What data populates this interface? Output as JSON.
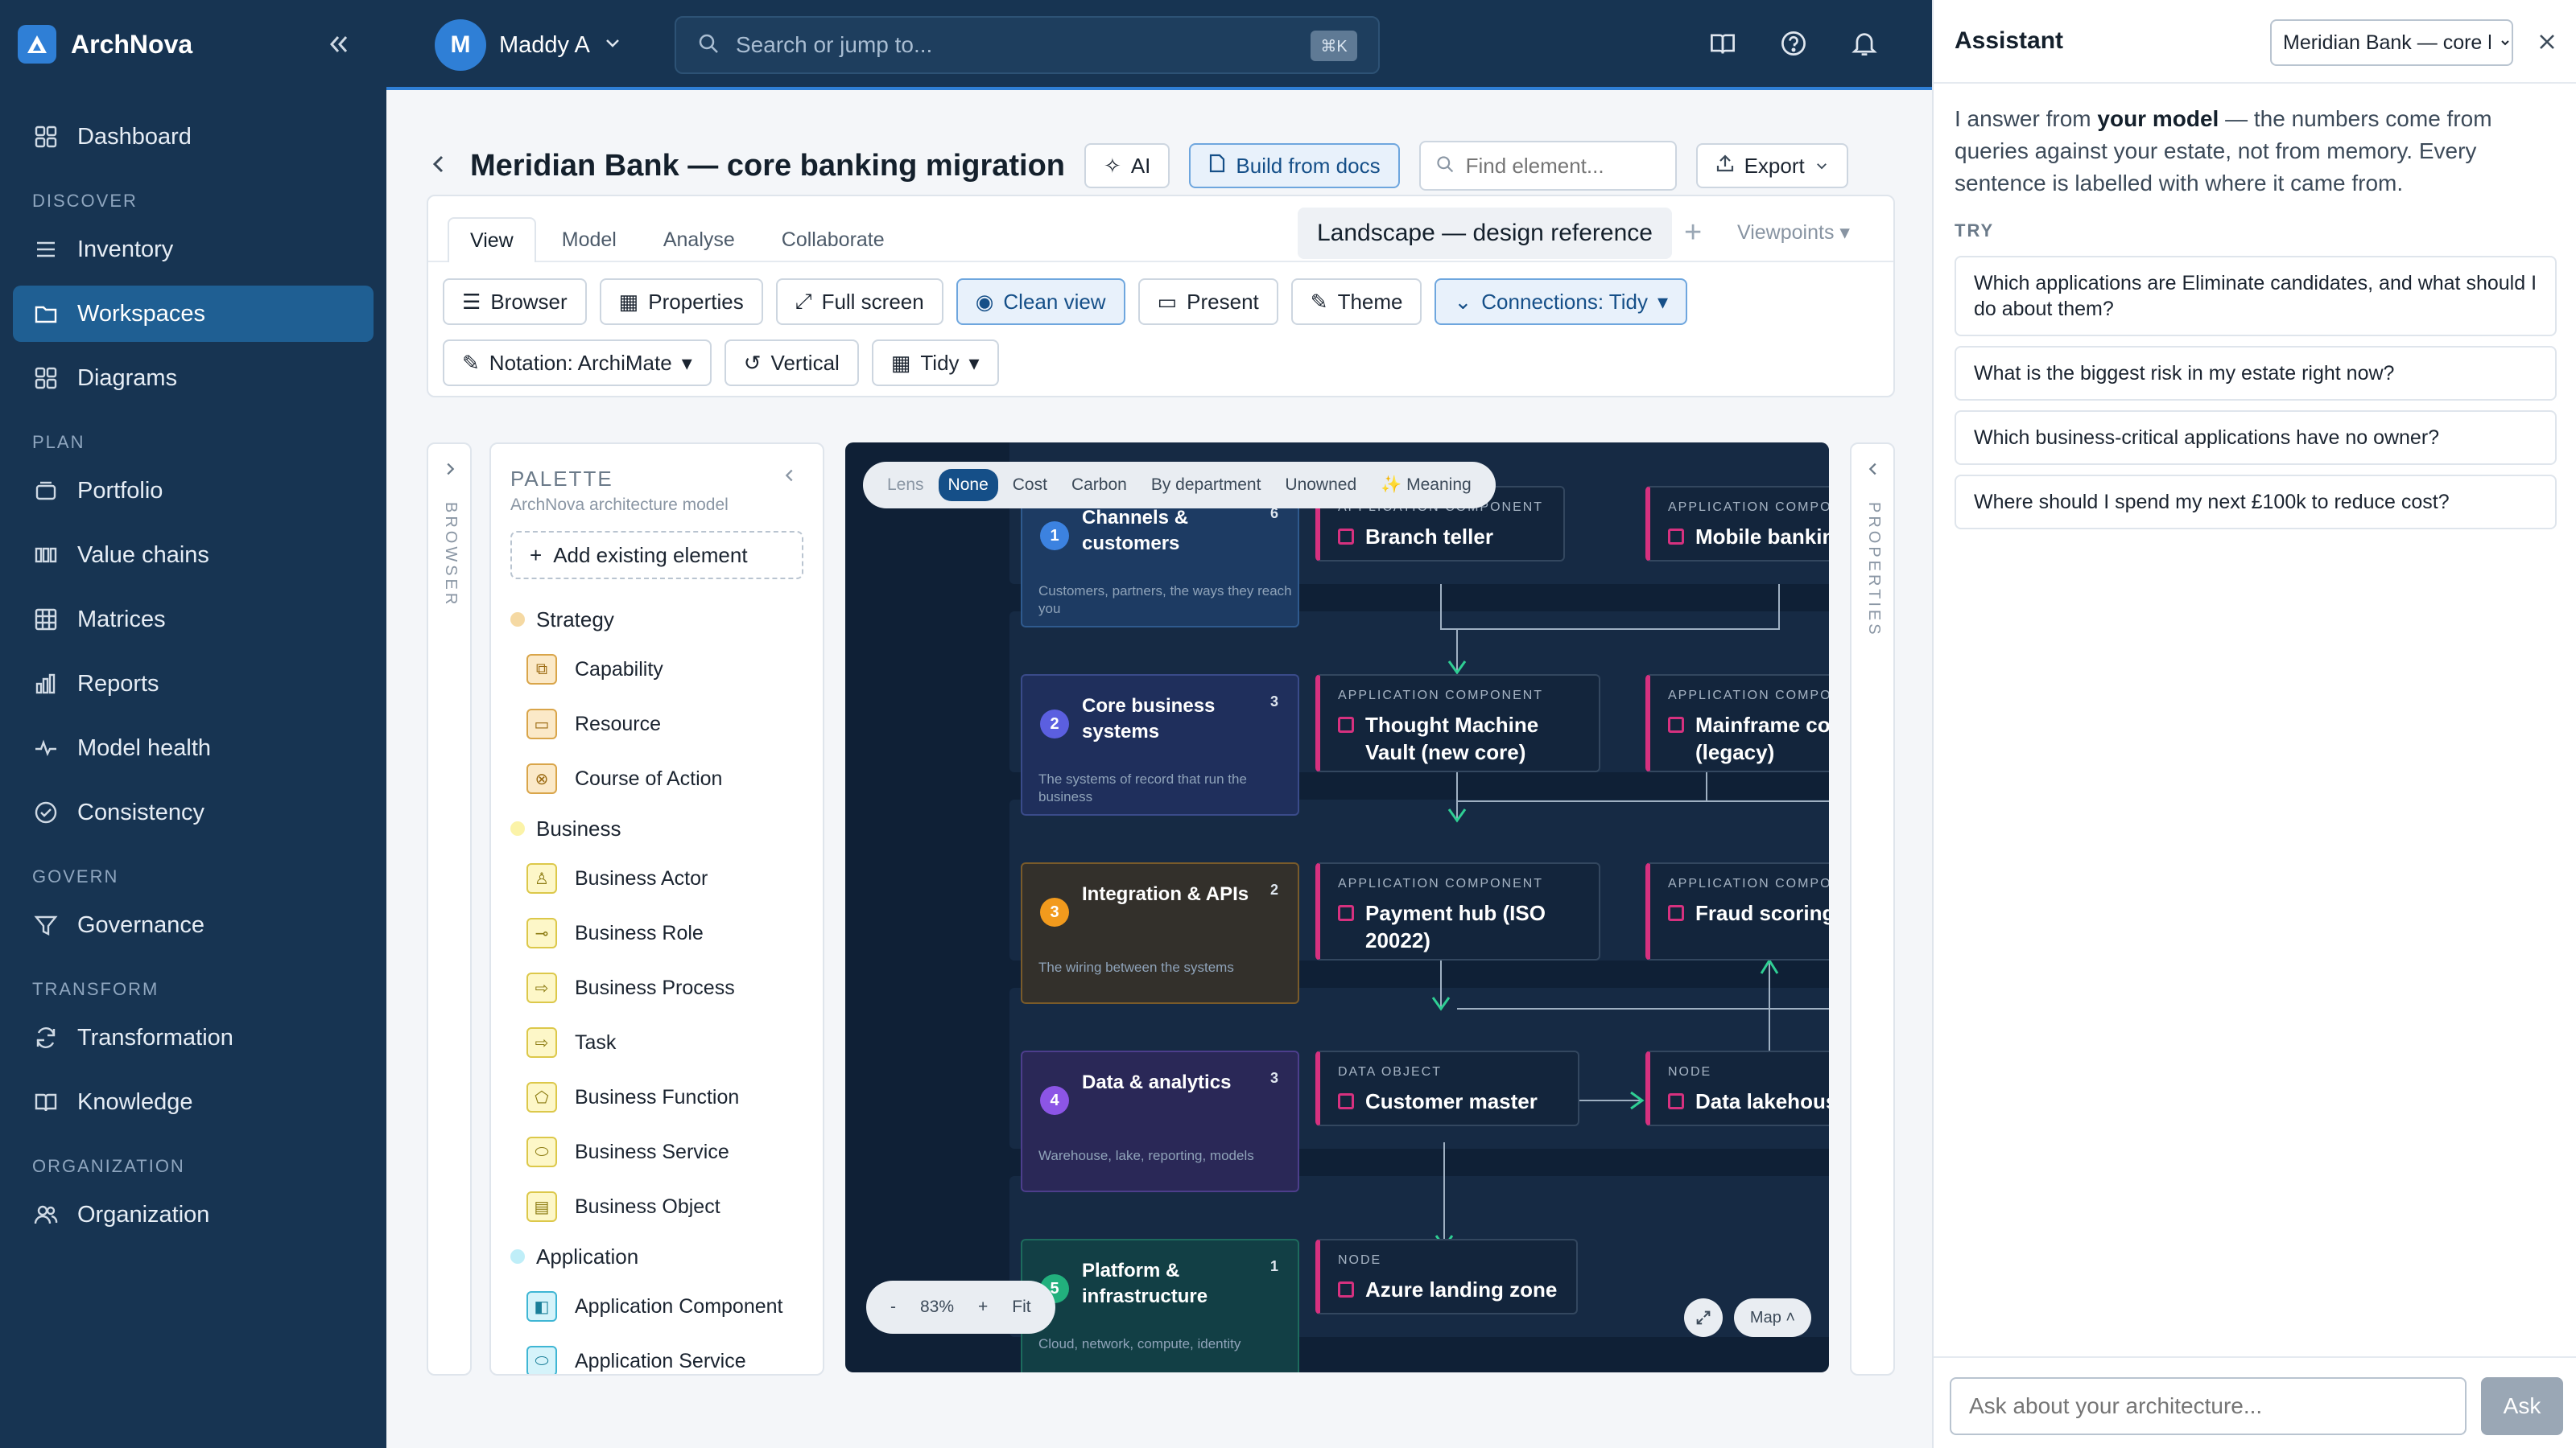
{
  "app": {
    "name": "ArchNova"
  },
  "sidebar": {
    "items": [
      {
        "label": "Dashboard"
      },
      {
        "section": "DISCOVER"
      },
      {
        "label": "Inventory"
      },
      {
        "label": "Workspaces",
        "active": true
      },
      {
        "label": "Diagrams"
      },
      {
        "section": "PLAN"
      },
      {
        "label": "Portfolio"
      },
      {
        "label": "Value chains"
      },
      {
        "label": "Matrices"
      },
      {
        "label": "Reports"
      },
      {
        "label": "Model health"
      },
      {
        "label": "Consistency"
      },
      {
        "section": "GOVERN"
      },
      {
        "label": "Governance"
      },
      {
        "section": "TRANSFORM"
      },
      {
        "label": "Transformation"
      },
      {
        "label": "Knowledge"
      },
      {
        "section": "ORGANIZATION"
      },
      {
        "label": "Organization"
      }
    ]
  },
  "topbar": {
    "user_initial": "M",
    "user_name": "Maddy A",
    "search_placeholder": "Search or jump to...",
    "search_shortcut": "⌘K"
  },
  "header": {
    "title": "Meridian Bank — core banking migration",
    "ai_label": "AI",
    "build_label": "Build from docs",
    "find_placeholder": "Find element...",
    "export_label": "Export"
  },
  "tabs": [
    "View",
    "Model",
    "Analyse",
    "Collaborate"
  ],
  "viewpoint": {
    "current": "Landscape — design reference",
    "more": "Viewpoints"
  },
  "toolbar": {
    "row1": [
      "Browser",
      "Properties",
      "Full screen",
      "Clean view",
      "Present",
      "Theme",
      "Connections: Tidy"
    ],
    "row2": [
      "Notation: ArchiMate",
      "Vertical",
      "Tidy"
    ]
  },
  "side_panels": {
    "left": "BROWSER",
    "right": "PROPERTIES"
  },
  "palette": {
    "title": "PALETTE",
    "subtitle": "ArchNova architecture model",
    "add_label": "Add existing element",
    "groups": [
      {
        "name": "Strategy",
        "color": "#f5d9a3",
        "items": [
          "Capability",
          "Resource",
          "Course of Action"
        ]
      },
      {
        "name": "Business",
        "color": "#fbf3a8",
        "items": [
          "Business Actor",
          "Business Role",
          "Business Process",
          "Task",
          "Business Function",
          "Business Service",
          "Business Object"
        ]
      },
      {
        "name": "Application",
        "color": "#bfeef8",
        "items": [
          "Application Component",
          "Application Service"
        ]
      }
    ]
  },
  "lens": {
    "label": "Lens",
    "options": [
      "None",
      "Cost",
      "Carbon",
      "By department",
      "Unowned",
      "✨ Meaning"
    ],
    "selected": "None"
  },
  "lanes": [
    {
      "num": "1",
      "title": "Channels & customers",
      "count": "6",
      "desc": "Customers, partners, the ways they reach you",
      "color": "#3c82e0"
    },
    {
      "num": "2",
      "title": "Core business systems",
      "count": "3",
      "desc": "The systems of record that run the business",
      "color": "#5b5fe0"
    },
    {
      "num": "3",
      "title": "Integration & APIs",
      "count": "2",
      "desc": "The wiring between the systems",
      "color": "#f29a1d"
    },
    {
      "num": "4",
      "title": "Data & analytics",
      "count": "3",
      "desc": "Warehouse, lake, reporting, models",
      "color": "#8c55e6"
    },
    {
      "num": "5",
      "title": "Platform & infrastructure",
      "count": "1",
      "desc": "Cloud, network, compute, identity",
      "color": "#22b07d"
    }
  ],
  "nodes": [
    {
      "kind": "APPLICATION COMPONENT",
      "name": "Branch teller"
    },
    {
      "kind": "APPLICATION COMPONENT",
      "name": "Mobile banking"
    },
    {
      "kind": "APPLICATION COMPONENT",
      "name": "Thought Machine Vault (new core)"
    },
    {
      "kind": "APPLICATION COMPONENT",
      "name": "Mainframe core (legacy)"
    },
    {
      "kind": "APPLICATION COMPONENT",
      "name": "Payment hub (ISO 20022)"
    },
    {
      "kind": "APPLICATION COMPONENT",
      "name": "Fraud scoring"
    },
    {
      "kind": "DATA OBJECT",
      "name": "Customer master"
    },
    {
      "kind": "NODE",
      "name": "Data lakehouse"
    },
    {
      "kind": "NODE",
      "name": "Azure landing zone"
    }
  ],
  "zoom": {
    "minus": "-",
    "level": "83%",
    "plus": "+",
    "fit": "Fit",
    "map": "Map"
  },
  "assistant": {
    "title": "Assistant",
    "model": "Meridian Bank — core banking migration",
    "intro_pre": "I answer from ",
    "intro_bold": "your model",
    "intro_post": " — the numbers come from queries against your estate, not from memory. Every sentence is labelled with where it came from.",
    "try_label": "TRY",
    "suggestions": [
      "Which applications are Eliminate candidates, and what should I do about them?",
      "What is the biggest risk in my estate right now?",
      "Which business-critical applications have no owner?",
      "Where should I spend my next £100k to reduce cost?"
    ],
    "input_placeholder": "Ask about your architecture...",
    "ask_label": "Ask"
  }
}
